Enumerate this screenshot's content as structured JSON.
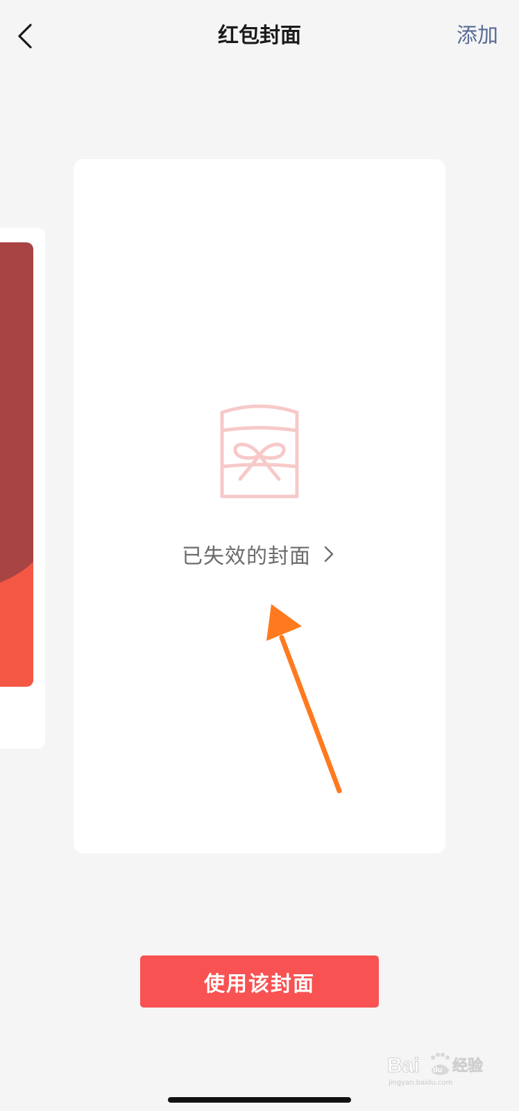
{
  "nav": {
    "title": "红包封面",
    "add_label": "添加",
    "back_icon": "chevron-left-icon"
  },
  "main_card": {
    "icon": "red-packet-gift-icon",
    "expired_label": "已失效的封面",
    "chevron_icon": "chevron-right-icon"
  },
  "action": {
    "use_button_label": "使用该封面"
  },
  "watermark": {
    "brand": "Bai du 经验",
    "url": "jingyan.baidu.com"
  },
  "colors": {
    "accent_red": "#f85252",
    "link_blue": "#576b95",
    "annotation_orange": "#ff7a1f",
    "icon_pink": "#f7c9c9",
    "cover_dark_red": "#a94444",
    "cover_bright_red": "#f45845"
  }
}
